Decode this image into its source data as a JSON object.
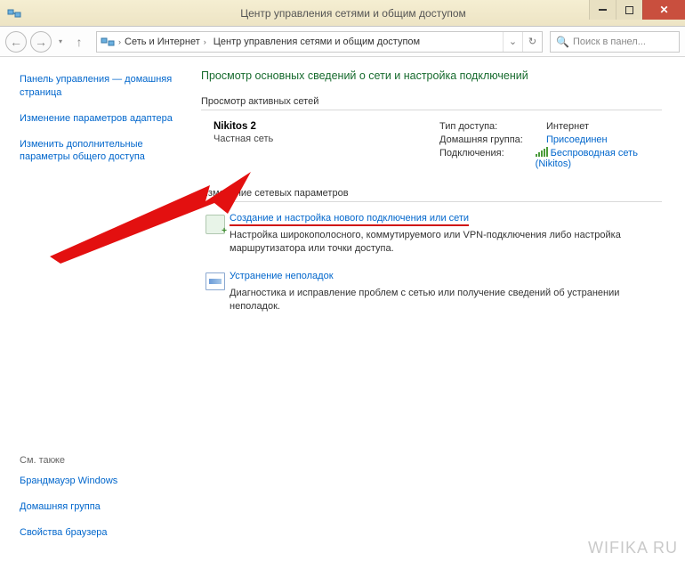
{
  "window": {
    "title": "Центр управления сетями и общим доступом"
  },
  "breadcrumb": {
    "seg1": "Сеть и Интернет",
    "seg2": "Центр управления сетями и общим доступом"
  },
  "search": {
    "placeholder": "Поиск в панел..."
  },
  "sidebar": {
    "links": [
      "Панель управления — домашняя страница",
      "Изменение параметров адаптера",
      "Изменить дополнительные параметры общего доступа"
    ],
    "footer_head": "См. также",
    "footer_links": [
      "Брандмауэр Windows",
      "Домашняя группа",
      "Свойства браузера"
    ]
  },
  "main": {
    "title": "Просмотр основных сведений о сети и настройка подключений",
    "active_head": "Просмотр активных сетей",
    "network": {
      "name": "Nikitos 2",
      "type": "Частная сеть",
      "access_label": "Тип доступа:",
      "access_val": "Интернет",
      "homegroup_label": "Домашняя группа:",
      "homegroup_val": "Присоединен",
      "conn_label": "Подключения:",
      "conn_val": "Беспроводная сеть (Nikitos)"
    },
    "change_head": "Изменение сетевых параметров",
    "opt1": {
      "link": "Создание и настройка нового подключения или сети",
      "desc": "Настройка широкополосного, коммутируемого или VPN-подключения либо настройка маршрутизатора или точки доступа."
    },
    "opt2": {
      "link": "Устранение неполадок",
      "desc": "Диагностика и исправление проблем с сетью или получение сведений об устранении неполадок."
    }
  },
  "watermark": "WIFIKA RU"
}
